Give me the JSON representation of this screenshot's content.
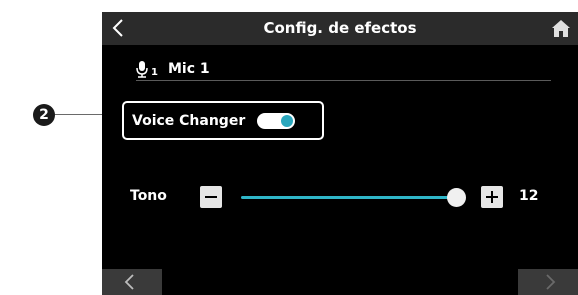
{
  "screen": {
    "title": "Config. de efectos",
    "back_icon": "chevron-left-icon",
    "home_icon": "home-icon"
  },
  "channel": {
    "icon": "microphone-icon",
    "subscript": "1",
    "name": "Mic 1"
  },
  "voice_changer": {
    "label": "Voice Changer",
    "enabled": true,
    "accent": "#2aa7bd"
  },
  "tono": {
    "label": "Tono",
    "value": "12",
    "track_color": "#2fb6c8"
  },
  "paging": {
    "prev_icon": "chevron-left-icon",
    "next_icon": "chevron-right-icon"
  },
  "callout": {
    "number": "2"
  }
}
